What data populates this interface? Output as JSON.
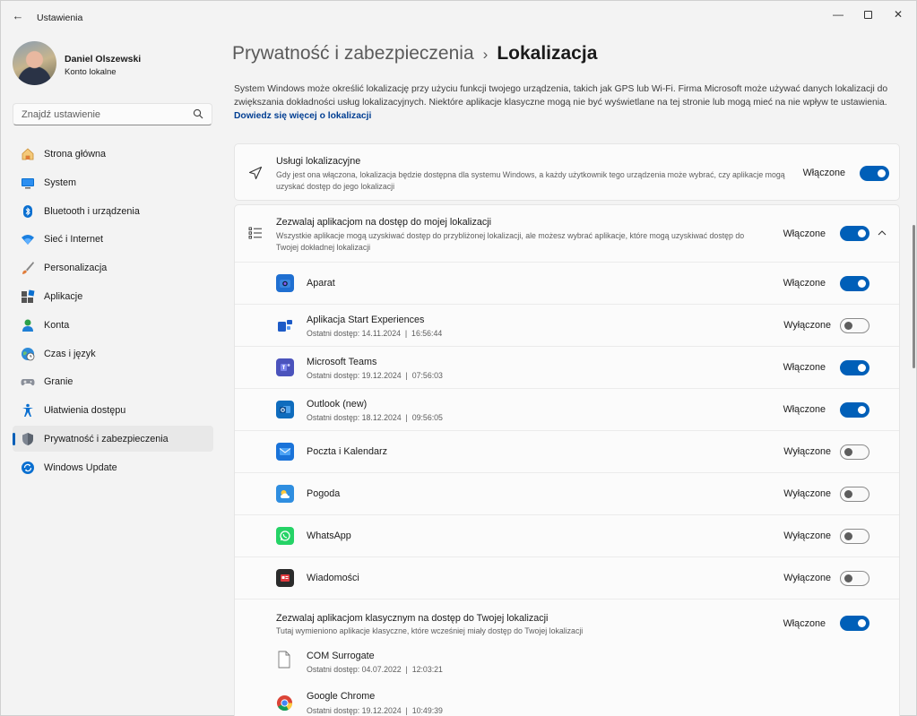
{
  "window": {
    "title": "Ustawienia",
    "back_glyph": "←",
    "minimize_glyph": "—",
    "close_glyph": "✕"
  },
  "profile": {
    "name": "Daniel Olszewski",
    "account_type": "Konto lokalne"
  },
  "search": {
    "placeholder": "Znajdź ustawienie"
  },
  "nav": [
    {
      "label": "Strona główna",
      "icon": "home-icon"
    },
    {
      "label": "System",
      "icon": "monitor-icon"
    },
    {
      "label": "Bluetooth i urządzenia",
      "icon": "bluetooth-icon"
    },
    {
      "label": "Sieć i Internet",
      "icon": "wifi-icon"
    },
    {
      "label": "Personalizacja",
      "icon": "brush-icon"
    },
    {
      "label": "Aplikacje",
      "icon": "apps-icon"
    },
    {
      "label": "Konta",
      "icon": "person-icon"
    },
    {
      "label": "Czas i język",
      "icon": "globe-clock-icon"
    },
    {
      "label": "Granie",
      "icon": "gamepad-icon"
    },
    {
      "label": "Ułatwienia dostępu",
      "icon": "accessibility-icon"
    },
    {
      "label": "Prywatność i zabezpieczenia",
      "icon": "shield-icon",
      "active": true
    },
    {
      "label": "Windows Update",
      "icon": "update-icon"
    }
  ],
  "breadcrumb": {
    "parent": "Prywatność i zabezpieczenia",
    "separator": "›",
    "current": "Lokalizacja"
  },
  "description": {
    "text": "System Windows może określić lokalizację przy użyciu funkcji twojego urządzenia, takich jak GPS lub Wi-Fi. Firma Microsoft może używać danych lokalizacji do zwiększania dokładności usług lokalizacyjnych. Niektóre aplikacje klasyczne mogą nie być wyświetlane na tej stronie lub mogą mieć na nie wpływ te ustawienia.",
    "link": "Dowiedz się więcej o lokalizacji"
  },
  "location_services": {
    "title": "Usługi lokalizacyjne",
    "subtitle": "Gdy jest ona włączona, lokalizacja będzie dostępna dla systemu Windows, a każdy użytkownik tego urządzenia może wybrać, czy aplikacje mogą uzyskać dostęp do jego lokalizacji",
    "state": "Włączone",
    "on": true
  },
  "app_access": {
    "title": "Zezwalaj aplikacjom na dostęp do mojej lokalizacji",
    "subtitle": "Wszystkie aplikacje mogą uzyskiwać dostęp do przybliżonej lokalizacji, ale możesz wybrać aplikacje, które mogą uzyskiwać dostęp do Twojej dokładnej lokalizacji",
    "state": "Włączone",
    "on": true
  },
  "apps": [
    {
      "name": "Aparat",
      "last": "",
      "state": "Włączone",
      "on": true,
      "icon": "camera-icon",
      "color": "#1f6fd1"
    },
    {
      "name": "Aplikacja Start Experiences",
      "last": "Ostatni dostęp: 14.11.2024  |  16:56:44",
      "state": "Wyłączone",
      "on": false,
      "icon": "start-experiences-icon",
      "color": "#1d5bc7"
    },
    {
      "name": "Microsoft Teams",
      "last": "Ostatni dostęp: 19.12.2024  |  07:56:03",
      "state": "Włączone",
      "on": true,
      "icon": "teams-icon",
      "color": "#4b53bc"
    },
    {
      "name": "Outlook (new)",
      "last": "Ostatni dostęp: 18.12.2024  |  09:56:05",
      "state": "Włączone",
      "on": true,
      "icon": "outlook-icon",
      "color": "#0f6cbd"
    },
    {
      "name": "Poczta i Kalendarz",
      "last": "",
      "state": "Wyłączone",
      "on": false,
      "icon": "mail-icon",
      "color": "#1a73d9"
    },
    {
      "name": "Pogoda",
      "last": "",
      "state": "Wyłączone",
      "on": false,
      "icon": "weather-icon",
      "color": "#2f8ee0"
    },
    {
      "name": "WhatsApp",
      "last": "",
      "state": "Wyłączone",
      "on": false,
      "icon": "whatsapp-icon",
      "color": "#25d366"
    },
    {
      "name": "Wiadomości",
      "last": "",
      "state": "Wyłączone",
      "on": false,
      "icon": "news-icon",
      "color": "#2b2b2b"
    }
  ],
  "classic_access": {
    "title": "Zezwalaj aplikacjom klasycznym na dostęp do Twojej lokalizacji",
    "subtitle": "Tutaj wymieniono aplikacje klasyczne, które wcześniej miały dostęp do Twojej lokalizacji",
    "state": "Włączone",
    "on": true
  },
  "classic_apps": [
    {
      "name": "COM Surrogate",
      "last": "Ostatni dostęp: 04.07.2022  |  12:03:21",
      "icon": "file-icon"
    },
    {
      "name": "Google Chrome",
      "last": "Ostatni dostęp: 19.12.2024  |  10:49:39",
      "icon": "chrome-icon"
    }
  ],
  "colors": {
    "accent": "#005fb8",
    "link": "#003e92"
  }
}
